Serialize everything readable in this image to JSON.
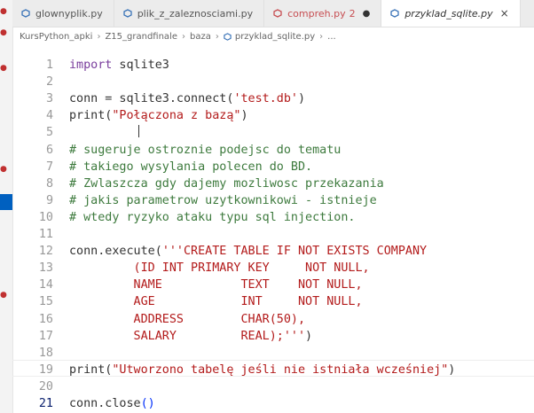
{
  "tabs": [
    {
      "label": "glownyplik.py",
      "active": false,
      "icon": "python-file-icon"
    },
    {
      "label": "plik_z_zaleznosciami.py",
      "active": false,
      "icon": "python-file-icon"
    },
    {
      "label": "compreh.py",
      "badge": "2",
      "modified": true,
      "error": true,
      "icon": "python-file-icon"
    },
    {
      "label": "przyklad_sqlite.py",
      "active": true,
      "close": "×",
      "icon": "python-file-icon"
    }
  ],
  "breadcrumb": [
    "KursPython_apki",
    "Z15_grandfinale",
    "baza",
    "przyklad_sqlite.py",
    "..."
  ],
  "editor": {
    "current_line": 21,
    "lines": [
      {
        "n": "1",
        "tokens": [
          [
            "k",
            "import"
          ],
          [
            "f",
            " sqlite3"
          ]
        ]
      },
      {
        "n": "2",
        "tokens": []
      },
      {
        "n": "3",
        "tokens": [
          [
            "f",
            "conn = sqlite3.connect("
          ],
          [
            "s",
            "'test.db'"
          ],
          [
            "f",
            ")"
          ]
        ]
      },
      {
        "n": "4",
        "tokens": [
          [
            "f",
            "print("
          ],
          [
            "s",
            "\"Połączona z bazą\""
          ],
          [
            "f",
            ")"
          ]
        ]
      },
      {
        "n": "5",
        "tokens": []
      },
      {
        "n": "6",
        "tokens": [
          [
            "c",
            "# sugeruje ostroznie podejsc do tematu"
          ]
        ]
      },
      {
        "n": "7",
        "tokens": [
          [
            "c",
            "# takiego wysylania polecen do BD."
          ]
        ]
      },
      {
        "n": "8",
        "tokens": [
          [
            "c",
            "# Zwlaszcza gdy dajemy mozliwosc przekazania"
          ]
        ]
      },
      {
        "n": "9",
        "tokens": [
          [
            "c",
            "# jakis parametrow uzytkownikowi - istnieje"
          ]
        ]
      },
      {
        "n": "10",
        "tokens": [
          [
            "c",
            "# wtedy ryzyko ataku typu sql injection."
          ]
        ]
      },
      {
        "n": "11",
        "tokens": []
      },
      {
        "n": "12",
        "tokens": [
          [
            "f",
            "conn.execute("
          ],
          [
            "s",
            "'''CREATE TABLE IF NOT EXISTS COMPANY"
          ]
        ]
      },
      {
        "n": "13",
        "tokens": [
          [
            "s",
            "         (ID INT PRIMARY KEY     NOT NULL,"
          ]
        ]
      },
      {
        "n": "14",
        "tokens": [
          [
            "s",
            "         NAME           TEXT    NOT NULL,"
          ]
        ]
      },
      {
        "n": "15",
        "tokens": [
          [
            "s",
            "         AGE            INT     NOT NULL,"
          ]
        ]
      },
      {
        "n": "16",
        "tokens": [
          [
            "s",
            "         ADDRESS        CHAR(50),"
          ]
        ]
      },
      {
        "n": "17",
        "tokens": [
          [
            "s",
            "         SALARY         REAL);'''"
          ],
          [
            "f",
            ")"
          ]
        ]
      },
      {
        "n": "18",
        "tokens": []
      },
      {
        "n": "19",
        "tokens": [
          [
            "f",
            "print("
          ],
          [
            "s",
            "\"Utworzono tabelę jeśli nie istniała wcześniej\""
          ],
          [
            "f",
            ")"
          ]
        ]
      },
      {
        "n": "20",
        "tokens": []
      },
      {
        "n": "21",
        "tokens": [
          [
            "f",
            "conn.close"
          ],
          [
            "p",
            "()"
          ]
        ]
      }
    ]
  },
  "colors": {
    "keyword": "#7a3e9d",
    "string": "#b31b1b",
    "comment": "#3d7a3d",
    "accent": "#0060c0"
  }
}
